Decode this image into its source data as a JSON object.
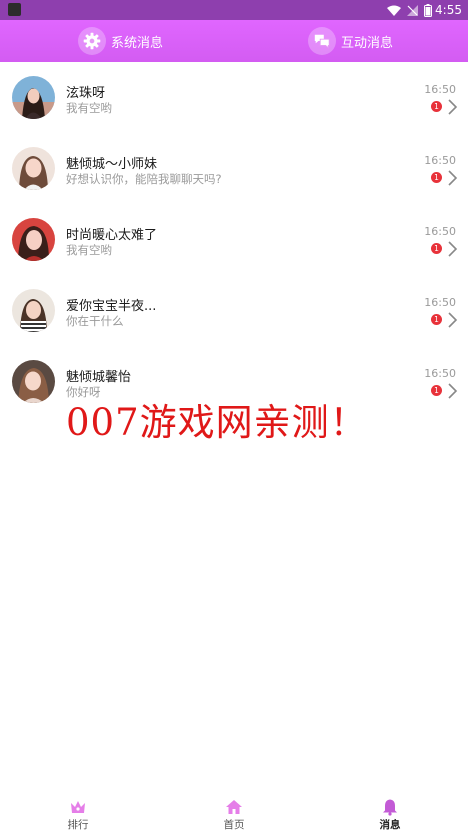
{
  "status_bar": {
    "time": "4:55",
    "icons": [
      "wifi-icon",
      "signal-icon",
      "battery-icon"
    ]
  },
  "header": {
    "tabs": [
      {
        "label": "系统消息",
        "icon": "gear-icon"
      },
      {
        "label": "互动消息",
        "icon": "chat-bubbles-icon"
      }
    ]
  },
  "messages": [
    {
      "name": "泫珠呀",
      "preview": "我有空哟",
      "time": "16:50",
      "unread": "1"
    },
    {
      "name": "魅倾城～小师妹",
      "preview": "好想认识你，能陪我聊聊天吗?",
      "time": "16:50",
      "unread": "1"
    },
    {
      "name": "时尚暖心太难了",
      "preview": "我有空哟",
      "time": "16:50",
      "unread": "1"
    },
    {
      "name": "爱你宝宝半夜...",
      "preview": "你在干什么",
      "time": "16:50",
      "unread": "1"
    },
    {
      "name": "魅倾城馨怡",
      "preview": "你好呀",
      "time": "16:50",
      "unread": "1"
    }
  ],
  "watermark": "007游戏网亲测！",
  "bottom_nav": [
    {
      "label": "排行",
      "icon": "crown-icon"
    },
    {
      "label": "首页",
      "icon": "home-icon"
    },
    {
      "label": "消息",
      "icon": "bell-icon",
      "active": true
    }
  ],
  "colors": {
    "header": "#d35cf2",
    "status_bar": "#8e3fae",
    "badge": "#e8323a",
    "watermark": "#e01818",
    "nav_icon": "#e57ee8"
  }
}
